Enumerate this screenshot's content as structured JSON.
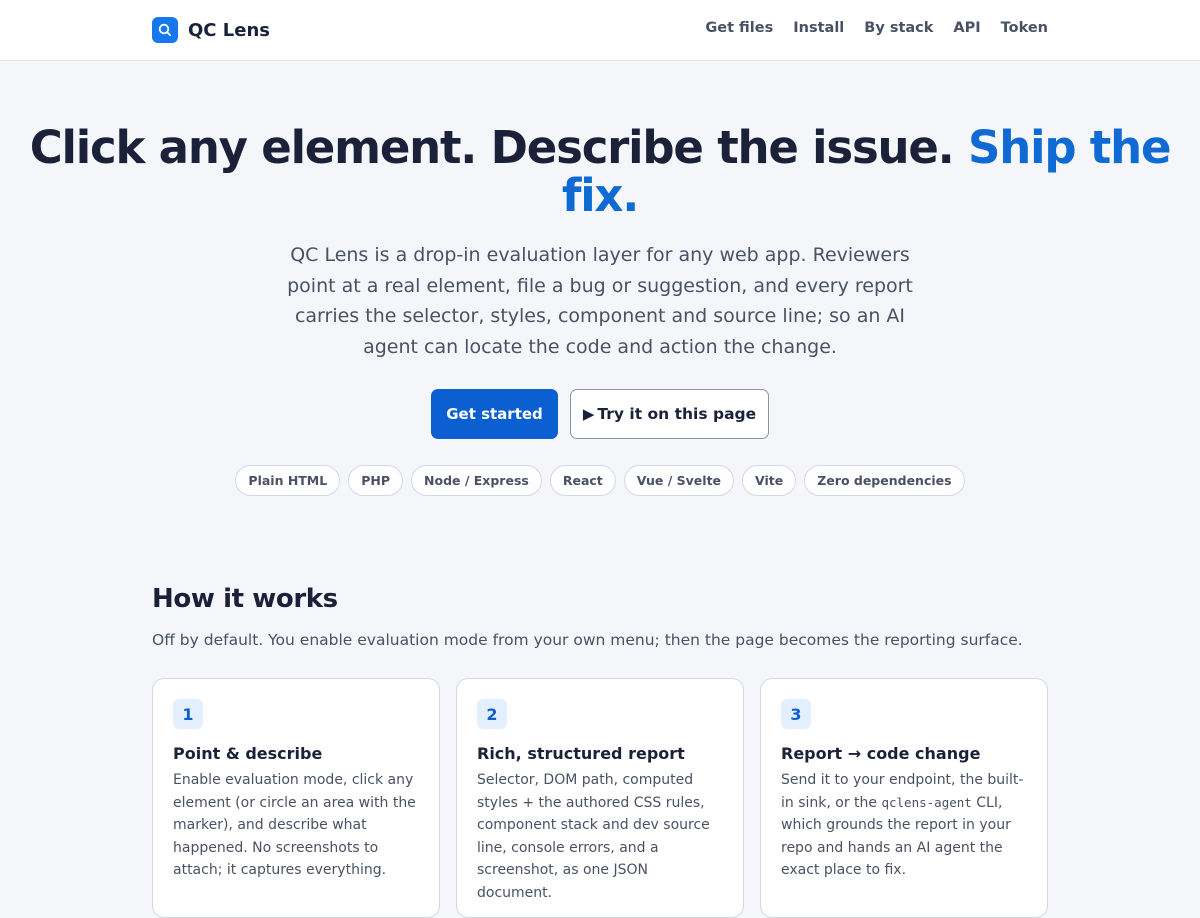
{
  "header": {
    "brand": "QC Lens",
    "nav": [
      "Get files",
      "Install",
      "By stack",
      "API",
      "Token"
    ]
  },
  "hero": {
    "title_part1": "Click any element. Describe the issue.",
    "title_accent": "Ship the fix.",
    "subtitle": "QC Lens is a drop-in evaluation layer for any web app. Reviewers point at a real element, file a bug or suggestion, and every report carries the selector, styles, component and source line; so an AI agent can locate the code and action the change.",
    "primary_cta": "Get started",
    "secondary_cta": "Try it on this page",
    "chips": [
      "Plain HTML",
      "PHP",
      "Node / Express",
      "React",
      "Vue / Svelte",
      "Vite",
      "Zero dependencies"
    ]
  },
  "how_it_works": {
    "title": "How it works",
    "subtitle": "Off by default. You enable evaluation mode from your own menu; then the page becomes the reporting surface.",
    "cards": [
      {
        "number": "1",
        "title": "Point & describe",
        "body": "Enable evaluation mode, click any element (or circle an area with the marker), and describe what happened. No screenshots to attach; it captures everything."
      },
      {
        "number": "2",
        "title": "Rich, structured report",
        "body": "Selector, DOM path, computed styles + the authored CSS rules, component stack and dev source line, console errors, and a screenshot, as one JSON document."
      },
      {
        "number": "3",
        "title": "Report → code change",
        "body_before": "Send it to your endpoint, the built-in sink, or the",
        "body_code": "qclens-agent",
        "body_after": "CLI, which grounds the report in your repo and hands an AI agent the exact place to fix."
      }
    ]
  },
  "colors": {
    "accent": "#0f6ad4",
    "primary_button": "#0b5fd0",
    "brand_mark": "#1677ef",
    "background": "#f4f6fa"
  }
}
